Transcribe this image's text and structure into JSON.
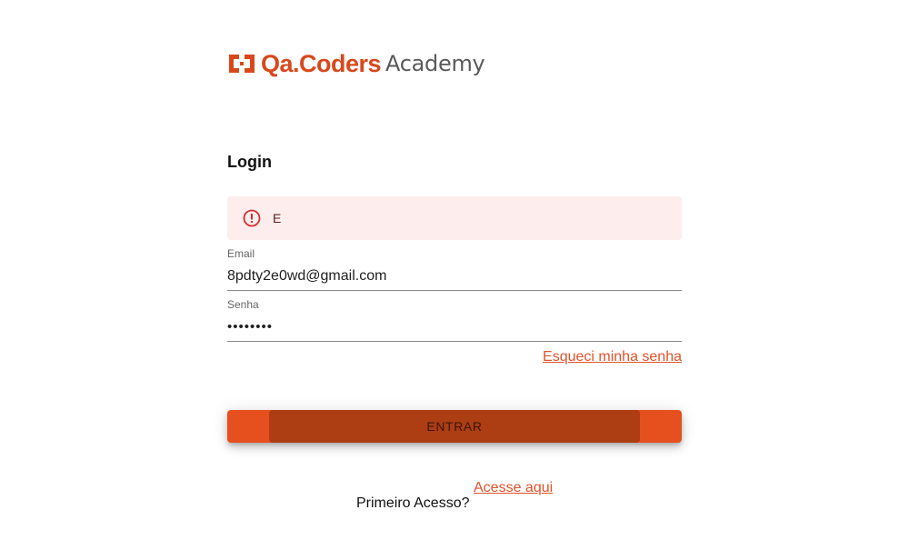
{
  "logo": {
    "brand": "Qa.Coders",
    "sub": "Academy",
    "icon": "brackets-logo-icon",
    "brand_color": "#d9481c"
  },
  "login": {
    "title": "Login"
  },
  "alert": {
    "icon": "error-outline-icon",
    "message": "E",
    "background": "#fdeded"
  },
  "email": {
    "label": "Email",
    "value": "8pdty2e0wd@gmail.com"
  },
  "password": {
    "label": "Senha",
    "value": "••••••••"
  },
  "forgot_link": "Esqueci minha senha",
  "submit": {
    "label": "ENTRAR",
    "color": "#e6501e"
  },
  "first_access": {
    "text": "Primeiro Acesso?",
    "link": "Acesse aqui"
  }
}
